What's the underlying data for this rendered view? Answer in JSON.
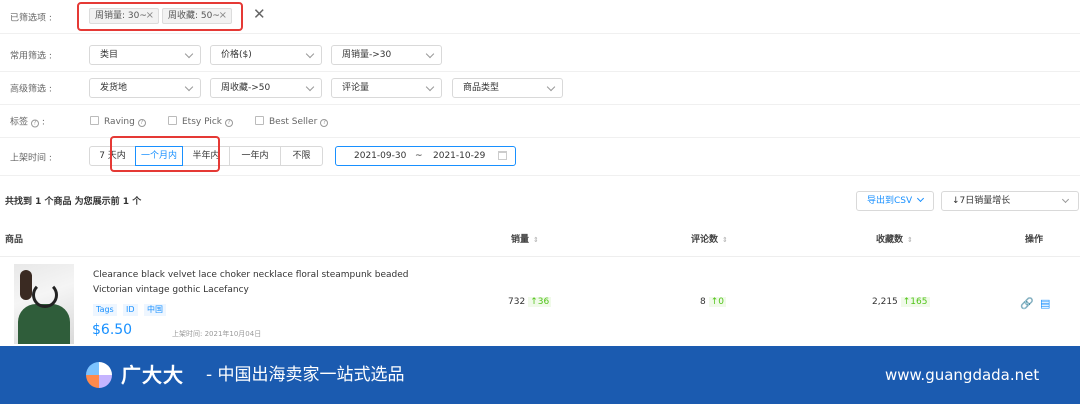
{
  "filters": {
    "selected_label": "已筛选项 :",
    "selected_chips": [
      "周销量: 30~",
      "周收藏: 50~"
    ],
    "clear_icon": "close-icon",
    "common_label": "常用筛选 :",
    "common_selects": [
      "类目",
      "价格($)",
      "周销量->30"
    ],
    "advanced_label": "高级筛选 :",
    "advanced_selects": [
      "发货地",
      "周收藏->50",
      "评论量",
      "商品类型"
    ],
    "tag_label": "标签",
    "tag_options": [
      "Raving",
      "Etsy Pick",
      "Best Seller"
    ],
    "listing_label": "上架时间 :",
    "time_options": [
      "7 天内",
      "一个月内",
      "半年内",
      "一年内",
      "不限"
    ],
    "active_time_option": "一个月内",
    "date_start": "2021-09-30",
    "date_sep": "~",
    "date_end": "2021-10-29"
  },
  "results": {
    "summary": "共找到 1 个商品   为您展示前 1 个",
    "export_label": "导出到CSV",
    "sort_label": "↓7日销量增长"
  },
  "table": {
    "headers": [
      "商品",
      "销量",
      "评论数",
      "收藏数",
      "操作"
    ],
    "rows": [
      {
        "title": "Clearance black velvet lace choker necklace floral steampunk beaded Victorian vintage gothic Lacefancy",
        "tags": [
          "Tags",
          "ID",
          "中国"
        ],
        "price": "$6.50",
        "listed": "上架时间: 2021年10月04日",
        "sales": "732",
        "sales_delta": "↑36",
        "reviews": "8",
        "reviews_delta": "↑0",
        "favorites": "2,215",
        "favorites_delta": "↑165"
      }
    ]
  },
  "footer": {
    "brand": "广大大",
    "slogan": "- 中国出海卖家一站式选品",
    "site": "www.guangdada.net"
  },
  "colors": {
    "accent": "#1890ff",
    "highlight_box": "#e53935",
    "footer_bg": "#1b5bb0",
    "increase": "#52c41a"
  }
}
